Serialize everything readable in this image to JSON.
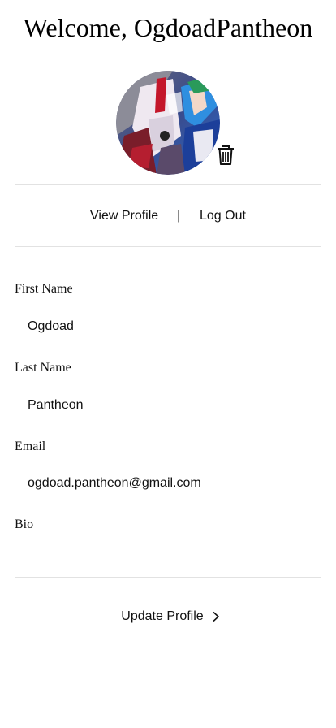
{
  "header": {
    "title": "Welcome, OgdoadPantheon"
  },
  "avatar": {
    "alt": "Profile picture",
    "delete_icon": "trash-icon"
  },
  "nav": {
    "view_profile": "View Profile",
    "separator": "|",
    "log_out": "Log Out"
  },
  "form": {
    "first_name": {
      "label": "First Name",
      "value": "Ogdoad"
    },
    "last_name": {
      "label": "Last Name",
      "value": "Pantheon"
    },
    "email": {
      "label": "Email",
      "value": "ogdoad.pantheon@gmail.com"
    },
    "bio": {
      "label": "Bio",
      "value": ""
    }
  },
  "actions": {
    "update_label": "Update Profile",
    "update_icon": "chevron-right-icon"
  }
}
